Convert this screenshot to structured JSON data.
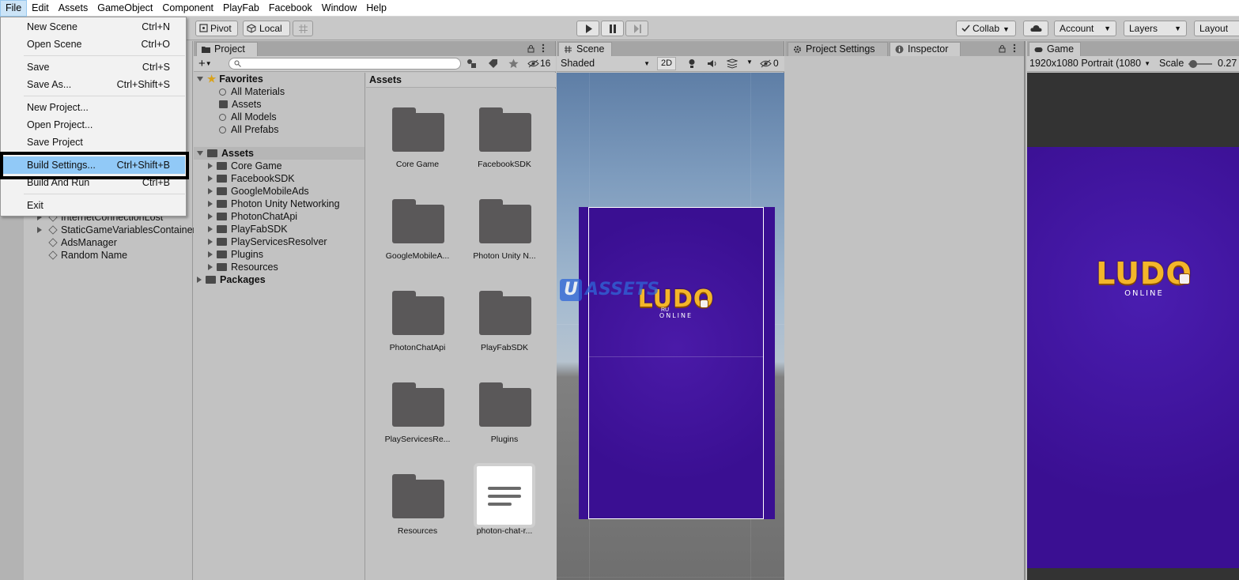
{
  "menubar": {
    "items": [
      "File",
      "Edit",
      "Assets",
      "GameObject",
      "Component",
      "PlayFab",
      "Facebook",
      "Window",
      "Help"
    ]
  },
  "toolbar": {
    "pivot": "Pivot",
    "local": "Local",
    "collab": "Collab",
    "account": "Account",
    "layers": "Layers",
    "layout": "Layout"
  },
  "file_menu": {
    "items": [
      {
        "label": "New Scene",
        "shortcut": "Ctrl+N"
      },
      {
        "label": "Open Scene",
        "shortcut": "Ctrl+O"
      },
      {
        "label": "Save",
        "shortcut": "Ctrl+S"
      },
      {
        "label": "Save As...",
        "shortcut": "Ctrl+Shift+S"
      },
      {
        "label": "New Project...",
        "shortcut": ""
      },
      {
        "label": "Open Project...",
        "shortcut": ""
      },
      {
        "label": "Save Project",
        "shortcut": ""
      },
      {
        "label": "Build Settings...",
        "shortcut": "Ctrl+Shift+B"
      },
      {
        "label": "Build And Run",
        "shortcut": "Ctrl+B"
      },
      {
        "label": "Exit",
        "shortcut": ""
      }
    ],
    "highlighted": "Build Settings..."
  },
  "hierarchy": {
    "items": [
      "InternetConnectionLost",
      "StaticGameVariablesContainer",
      "AdsManager",
      "Random Name"
    ]
  },
  "project": {
    "tab": "Project",
    "hidden_count": "16",
    "tree": {
      "favorites_label": "Favorites",
      "favorites": [
        "All Materials",
        "Assets",
        "All Models",
        "All Prefabs"
      ],
      "assets_label": "Assets",
      "assets": [
        "Core Game",
        "FacebookSDK",
        "GoogleMobileAds",
        "Photon Unity Networking",
        "PhotonChatApi",
        "PlayFabSDK",
        "PlayServicesResolver",
        "Plugins",
        "Resources"
      ],
      "packages_label": "Packages"
    },
    "grid_header": "Assets",
    "grid": [
      "Core Game",
      "FacebookSDK",
      "GoogleMobileA...",
      "Photon Unity N...",
      "PhotonChatApi",
      "PlayFabSDK",
      "PlayServicesRe...",
      "Plugins",
      "Resources",
      "photon-chat-r..."
    ]
  },
  "scene": {
    "tab": "Scene",
    "shading": "Shaded",
    "mode_2d": "2D",
    "hidden_count": "0"
  },
  "inspector": {
    "tab_settings": "Project Settings",
    "tab_inspector": "Inspector"
  },
  "game": {
    "tab": "Game",
    "resolution": "1920x1080 Portrait (1080",
    "scale_label": "Scale",
    "scale_value": "0.27"
  },
  "logo": {
    "title": "LUDO",
    "subtitle": "ONLINE",
    "scene_small": "RU"
  },
  "watermark": {
    "u": "U",
    "text": "ASSETS"
  },
  "colors": {
    "menu_highlight": "#91c9f7",
    "folder": "#5a5859",
    "game_bg": "#3a0f92",
    "logo_gold": "#f3b62a"
  }
}
